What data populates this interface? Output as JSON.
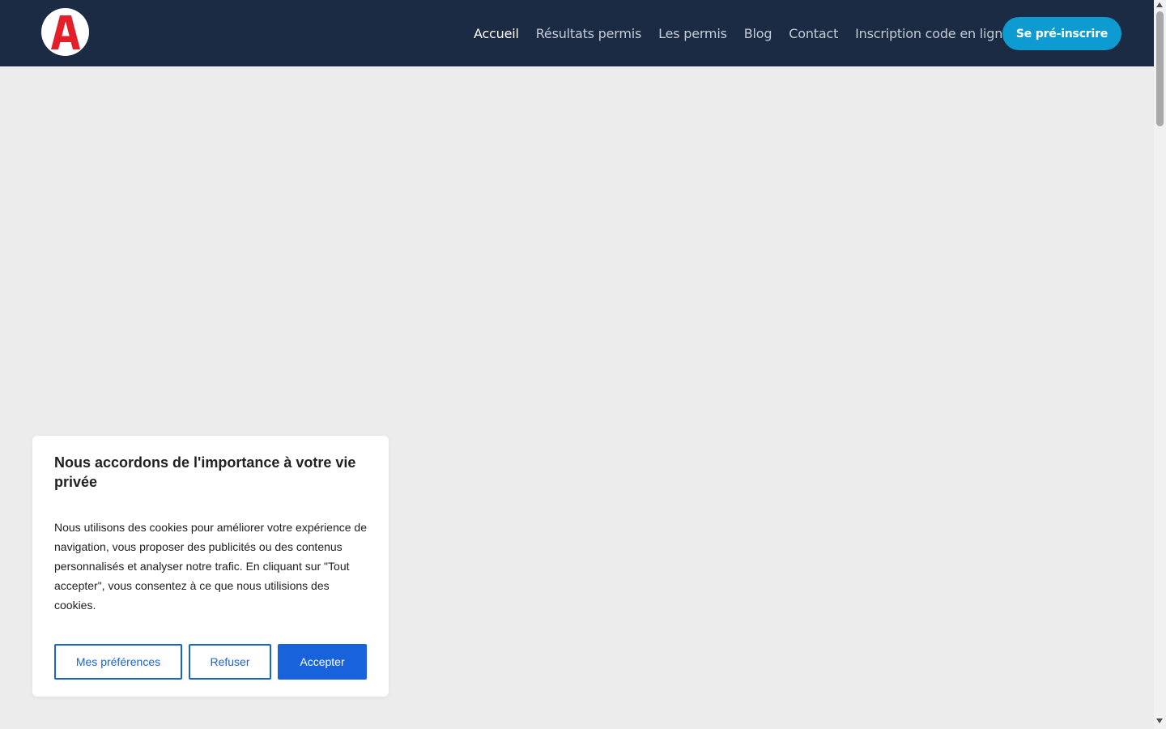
{
  "header": {
    "logo_letter": "A",
    "nav": [
      {
        "label": "Accueil",
        "active": true
      },
      {
        "label": "Résultats permis"
      },
      {
        "label": "Les permis"
      },
      {
        "label": "Blog"
      },
      {
        "label": "Contact"
      },
      {
        "label": "Inscription code en ligne"
      }
    ],
    "cta_label": "Se pré-inscrire"
  },
  "cookie_banner": {
    "title": "Nous accordons de l'importance à votre vie privée",
    "text": "Nous utilisons des cookies pour améliorer votre expérience de navigation, vous proposer des publicités ou des contenus personnalisés et analyser notre trafic. En cliquant sur \"Tout accepter\", vous consentez à ce que nous utilisions des cookies.",
    "buttons": {
      "preferences": "Mes préférences",
      "refuse": "Refuser",
      "accept": "Accepter"
    }
  },
  "colors": {
    "header_bg": "#1b2b44",
    "cta_bg": "#0e9bd1",
    "accent": "#1863dc",
    "logo_red": "#e3202a",
    "page_bg": "#ececec"
  },
  "icons": [
    "logo-a-icon"
  ]
}
